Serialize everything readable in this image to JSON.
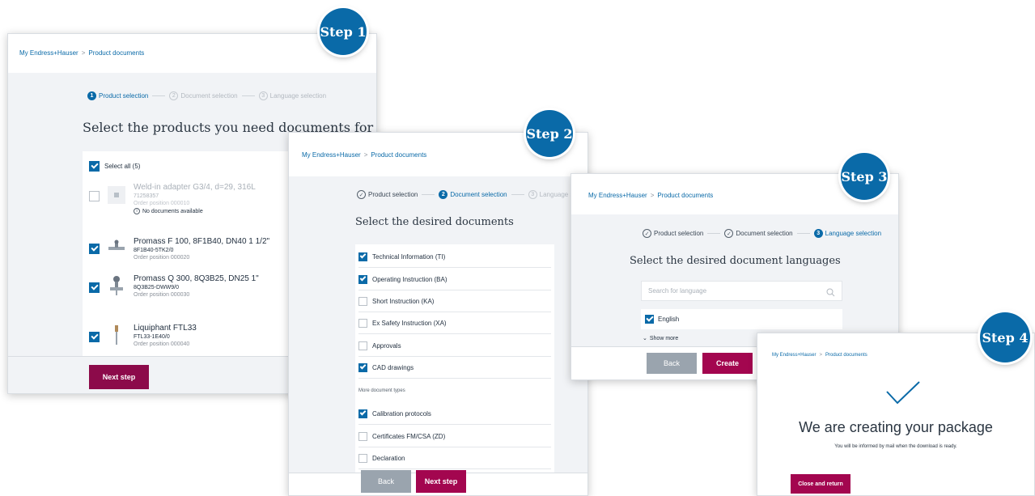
{
  "step_badges": [
    "Step 1",
    "Step 2",
    "Step 3",
    "Step 4"
  ],
  "breadcrumb": {
    "home": "My Endress+Hauser",
    "separator": ">",
    "current": "Product documents"
  },
  "stepper": {
    "num1": "1",
    "num2": "2",
    "num3": "3",
    "product": "Product selection",
    "document": "Document selection",
    "language": "Language selection"
  },
  "panel1": {
    "heading": "Select the products you need documents for",
    "select_all": "Select all (5)",
    "products": [
      {
        "title": "Weld-in adapter G3/4, d=29, 316L",
        "code": "71258357",
        "position": "Order position 000010",
        "note": "No documents available",
        "checked": false
      },
      {
        "title": "Promass F 100, 8F1B40, DN40 1 1/2\"",
        "code": "8F1B40-5TK2/0",
        "position": "Order position 000020",
        "checked": true
      },
      {
        "title": "Promass Q 300, 8Q3B25, DN25 1\"",
        "code": "8Q3B25-DWW9/0",
        "position": "Order position 000030",
        "checked": true
      },
      {
        "title": "Liquiphant FTL33",
        "code": "FTL33-1E40/0",
        "position": "Order position 000040",
        "checked": true
      }
    ],
    "next_button": "Next step"
  },
  "panel2": {
    "heading": "Select the desired documents",
    "documents": [
      {
        "label": "Technical Information (TI)",
        "checked": true
      },
      {
        "label": "Operating Instruction (BA)",
        "checked": true
      },
      {
        "label": "Short Instruction (KA)",
        "checked": false
      },
      {
        "label": "Ex Safety Instruction (XA)",
        "checked": false
      },
      {
        "label": "Approvals",
        "checked": false
      },
      {
        "label": "CAD drawings",
        "checked": true
      }
    ],
    "more_types_label": "More document types",
    "more_documents": [
      {
        "label": "Calibration protocols",
        "checked": true
      },
      {
        "label": "Certificates FM/CSA (ZD)",
        "checked": false
      },
      {
        "label": "Declaration",
        "checked": false
      }
    ],
    "back_button": "Back",
    "next_button": "Next step"
  },
  "panel3": {
    "heading": "Select the desired document languages",
    "search_placeholder": "Search for language",
    "language": "English",
    "show_more": "Show more",
    "back_button": "Back",
    "create_button": "Create"
  },
  "panel4": {
    "heading": "We are creating your package",
    "subtext": "You will be informed by mail when the download is ready.",
    "close_button": "Close and return"
  },
  "colors": {
    "accent_blue": "#0a6aa8",
    "primary_button": "#a3064f",
    "secondary_button": "#9aa4ae",
    "content_bg": "#f1f3f6"
  }
}
